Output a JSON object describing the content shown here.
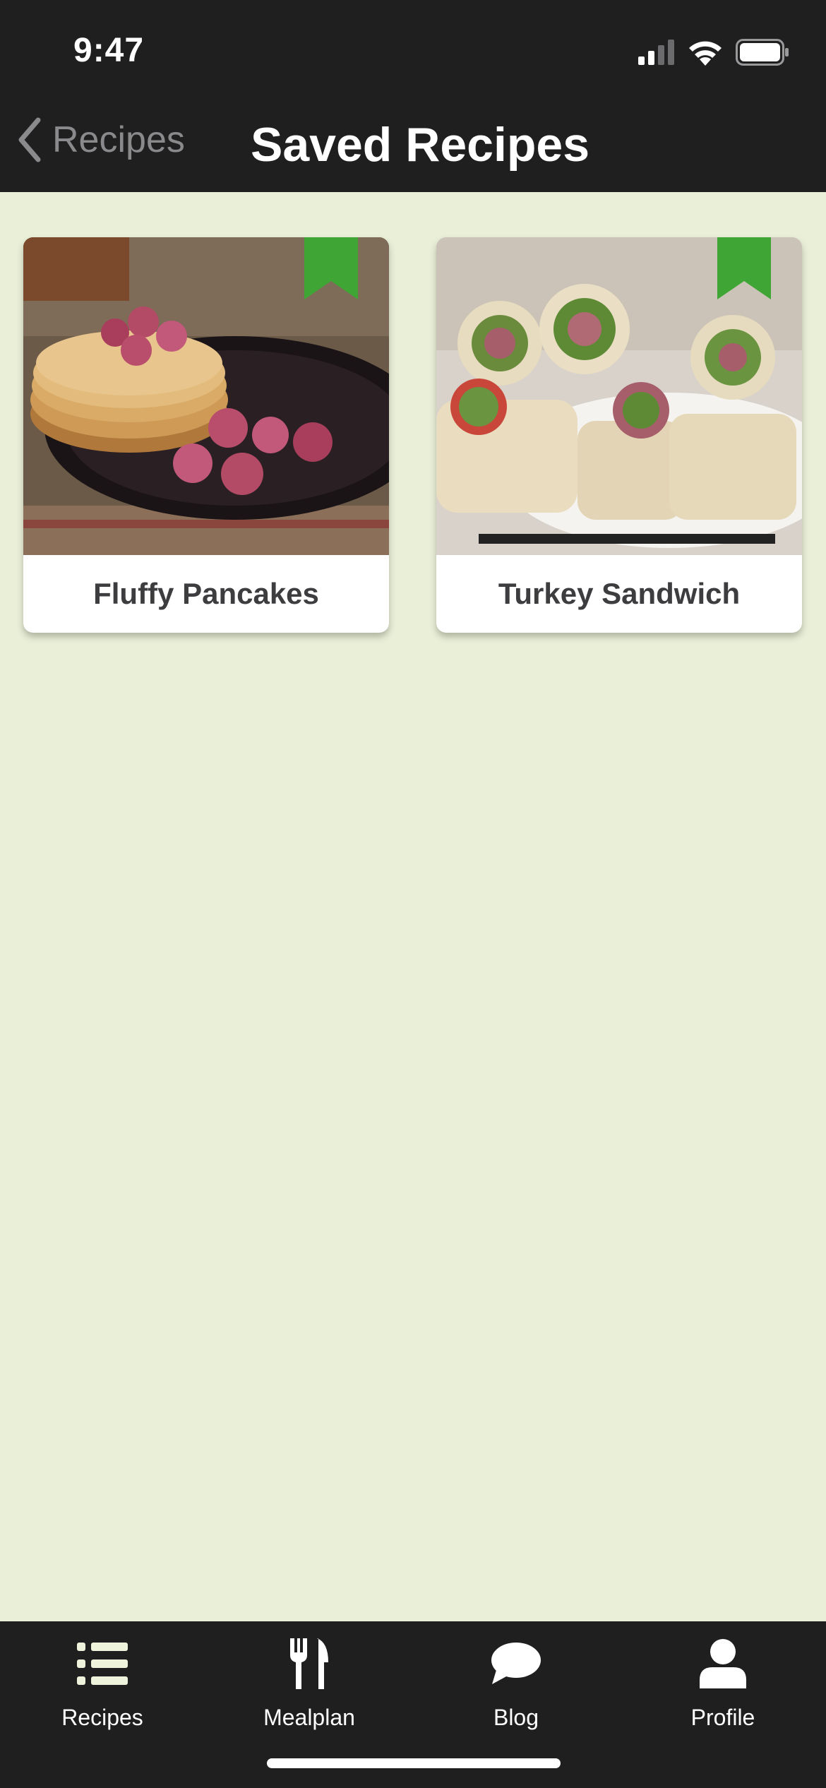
{
  "status_bar": {
    "time": "9:47"
  },
  "nav": {
    "back_label": "Recipes",
    "title": "Saved Recipes"
  },
  "recipes": [
    {
      "name": "Fluffy Pancakes",
      "bookmarked": true
    },
    {
      "name": "Turkey Sandwich",
      "bookmarked": true
    }
  ],
  "tabbar": {
    "tabs": [
      {
        "label": "Recipes",
        "icon": "list-icon"
      },
      {
        "label": "Mealplan",
        "icon": "fork-knife-icon"
      },
      {
        "label": "Blog",
        "icon": "speech-bubble-icon"
      },
      {
        "label": "Profile",
        "icon": "person-icon"
      }
    ]
  },
  "colors": {
    "accent": "#3fa535",
    "background": "#eaf0d8",
    "bar": "#1f1f20"
  }
}
